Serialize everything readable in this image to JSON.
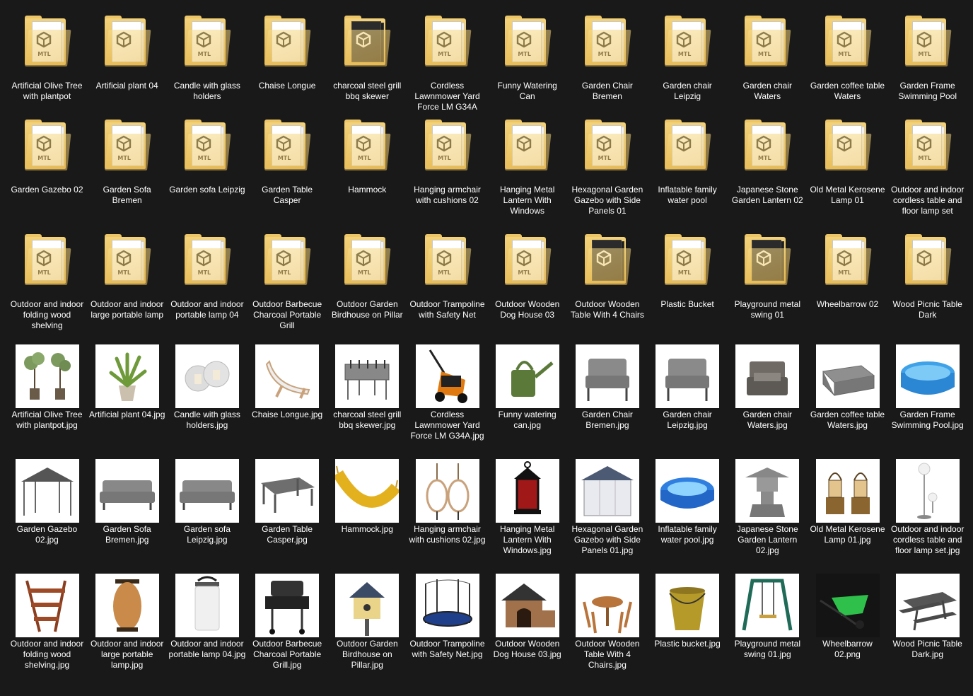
{
  "folders": [
    {
      "label": "Artificial Olive Tree with plantpot",
      "mode": "mtl"
    },
    {
      "label": "Artificial plant 04",
      "mode": "cube"
    },
    {
      "label": "Candle with glass holders",
      "mode": "mtl"
    },
    {
      "label": "Chaise Longue",
      "mode": "cube"
    },
    {
      "label": "charcoal steel grill bbq skewer",
      "mode": "dark"
    },
    {
      "label": "Cordless Lawnmower Yard Force LM G34A",
      "mode": "mtl"
    },
    {
      "label": "Funny Watering Can",
      "mode": "mtl"
    },
    {
      "label": "Garden Chair Bremen",
      "mode": "mtl"
    },
    {
      "label": "Garden chair Leipzig",
      "mode": "mtl"
    },
    {
      "label": "Garden chair Waters",
      "mode": "mtl"
    },
    {
      "label": "Garden coffee table Waters",
      "mode": "mtl"
    },
    {
      "label": "Garden Frame Swimming Pool",
      "mode": "mtl"
    },
    {
      "label": "Garden Gazebo 02",
      "mode": "mtl"
    },
    {
      "label": "Garden Sofa Bremen",
      "mode": "mtl"
    },
    {
      "label": "Garden sofa Leipzig",
      "mode": "mtl"
    },
    {
      "label": "Garden Table Casper",
      "mode": "mtl"
    },
    {
      "label": "Hammock",
      "mode": "mtl"
    },
    {
      "label": "Hanging armchair with cushions 02",
      "mode": "mtl"
    },
    {
      "label": "Hanging Metal Lantern With Windows",
      "mode": "cube"
    },
    {
      "label": "Hexagonal Garden Gazebo with Side Panels 01",
      "mode": "mtl"
    },
    {
      "label": "Inflatable family water pool",
      "mode": "cube"
    },
    {
      "label": "Japanese Stone Garden Lantern 02",
      "mode": "mtl"
    },
    {
      "label": "Old Metal Kerosene Lamp 01",
      "mode": "cube"
    },
    {
      "label": "Outdoor and indoor cordless table and floor lamp set",
      "mode": "mtl"
    },
    {
      "label": "Outdoor and indoor folding wood shelving",
      "mode": "mtl"
    },
    {
      "label": "Outdoor and indoor large portable lamp",
      "mode": "mtl"
    },
    {
      "label": "Outdoor and indoor portable lamp 04",
      "mode": "mtl"
    },
    {
      "label": "Outdoor Barbecue Charcoal Portable Grill",
      "mode": "mtl"
    },
    {
      "label": "Outdoor Garden Birdhouse on Pillar",
      "mode": "mtl"
    },
    {
      "label": "Outdoor Trampoline with Safety Net",
      "mode": "mtl"
    },
    {
      "label": "Outdoor Wooden Dog House 03",
      "mode": "mtl"
    },
    {
      "label": "Outdoor Wooden Table With 4 Chairs",
      "mode": "dark"
    },
    {
      "label": "Plastic Bucket",
      "mode": "mtl"
    },
    {
      "label": "Playground metal swing 01",
      "mode": "dark"
    },
    {
      "label": "Wheelbarrow 02",
      "mode": "mtl"
    },
    {
      "label": "Wood Picnic Table Dark",
      "mode": "cube"
    }
  ],
  "images": [
    {
      "label": "Artificial Olive Tree with plantpot.jpg",
      "icon": "olive-tree"
    },
    {
      "label": "Artificial plant 04.jpg",
      "icon": "potted-plant"
    },
    {
      "label": "Candle with glass holders.jpg",
      "icon": "candle-holders"
    },
    {
      "label": "Chaise Longue.jpg",
      "icon": "chaise-longue"
    },
    {
      "label": "charcoal steel grill bbq skewer.jpg",
      "icon": "bbq-grill"
    },
    {
      "label": "Cordless Lawnmower Yard Force LM G34A.jpg",
      "icon": "lawnmower"
    },
    {
      "label": "Funny watering can.jpg",
      "icon": "watering-can"
    },
    {
      "label": "Garden Chair Bremen.jpg",
      "icon": "armchair"
    },
    {
      "label": "Garden chair Leipzig.jpg",
      "icon": "armchair"
    },
    {
      "label": "Garden chair Waters.jpg",
      "icon": "wicker-chair"
    },
    {
      "label": "Garden coffee table Waters.jpg",
      "icon": "coffee-table"
    },
    {
      "label": "Garden Frame Swimming Pool.jpg",
      "icon": "pool"
    },
    {
      "label": "Garden Gazebo 02.jpg",
      "icon": "gazebo"
    },
    {
      "label": "Garden Sofa Bremen.jpg",
      "icon": "sofa"
    },
    {
      "label": "Garden sofa Leipzig.jpg",
      "icon": "sofa"
    },
    {
      "label": "Garden Table Casper.jpg",
      "icon": "table"
    },
    {
      "label": "Hammock.jpg",
      "icon": "hammock"
    },
    {
      "label": "Hanging armchair with cushions 02.jpg",
      "icon": "hanging-chair"
    },
    {
      "label": "Hanging Metal Lantern With Windows.jpg",
      "icon": "lantern"
    },
    {
      "label": "Hexagonal Garden Gazebo with Side Panels 01.jpg",
      "icon": "gazebo-panels"
    },
    {
      "label": "Inflatable family water pool.jpg",
      "icon": "inflatable-pool"
    },
    {
      "label": "Japanese Stone Garden Lantern 02.jpg",
      "icon": "stone-lantern"
    },
    {
      "label": "Old Metal Kerosene Lamp 01.jpg",
      "icon": "kerosene-lamp"
    },
    {
      "label": "Outdoor and indoor cordless table and floor lamp set.jpg",
      "icon": "floor-lamp"
    },
    {
      "label": "Outdoor and indoor folding wood shelving.jpg",
      "icon": "wood-shelving"
    },
    {
      "label": "Outdoor and indoor large portable lamp.jpg",
      "icon": "large-lamp"
    },
    {
      "label": "Outdoor and indoor portable lamp 04.jpg",
      "icon": "portable-lamp"
    },
    {
      "label": "Outdoor Barbecue Charcoal Portable Grill.jpg",
      "icon": "charcoal-grill"
    },
    {
      "label": "Outdoor Garden Birdhouse on Pillar.jpg",
      "icon": "birdhouse"
    },
    {
      "label": "Outdoor Trampoline with Safety Net.jpg",
      "icon": "trampoline"
    },
    {
      "label": "Outdoor Wooden Dog House 03.jpg",
      "icon": "dog-house"
    },
    {
      "label": "Outdoor Wooden Table With 4 Chairs.jpg",
      "icon": "table-chairs"
    },
    {
      "label": "Plastic bucket.jpg",
      "icon": "bucket"
    },
    {
      "label": "Playground metal swing 01.jpg",
      "icon": "swing"
    },
    {
      "label": "Wheelbarrow 02.png",
      "icon": "wheelbarrow"
    },
    {
      "label": "Wood Picnic Table Dark.jpg",
      "icon": "picnic-table"
    }
  ],
  "mtl_text": "MTL"
}
